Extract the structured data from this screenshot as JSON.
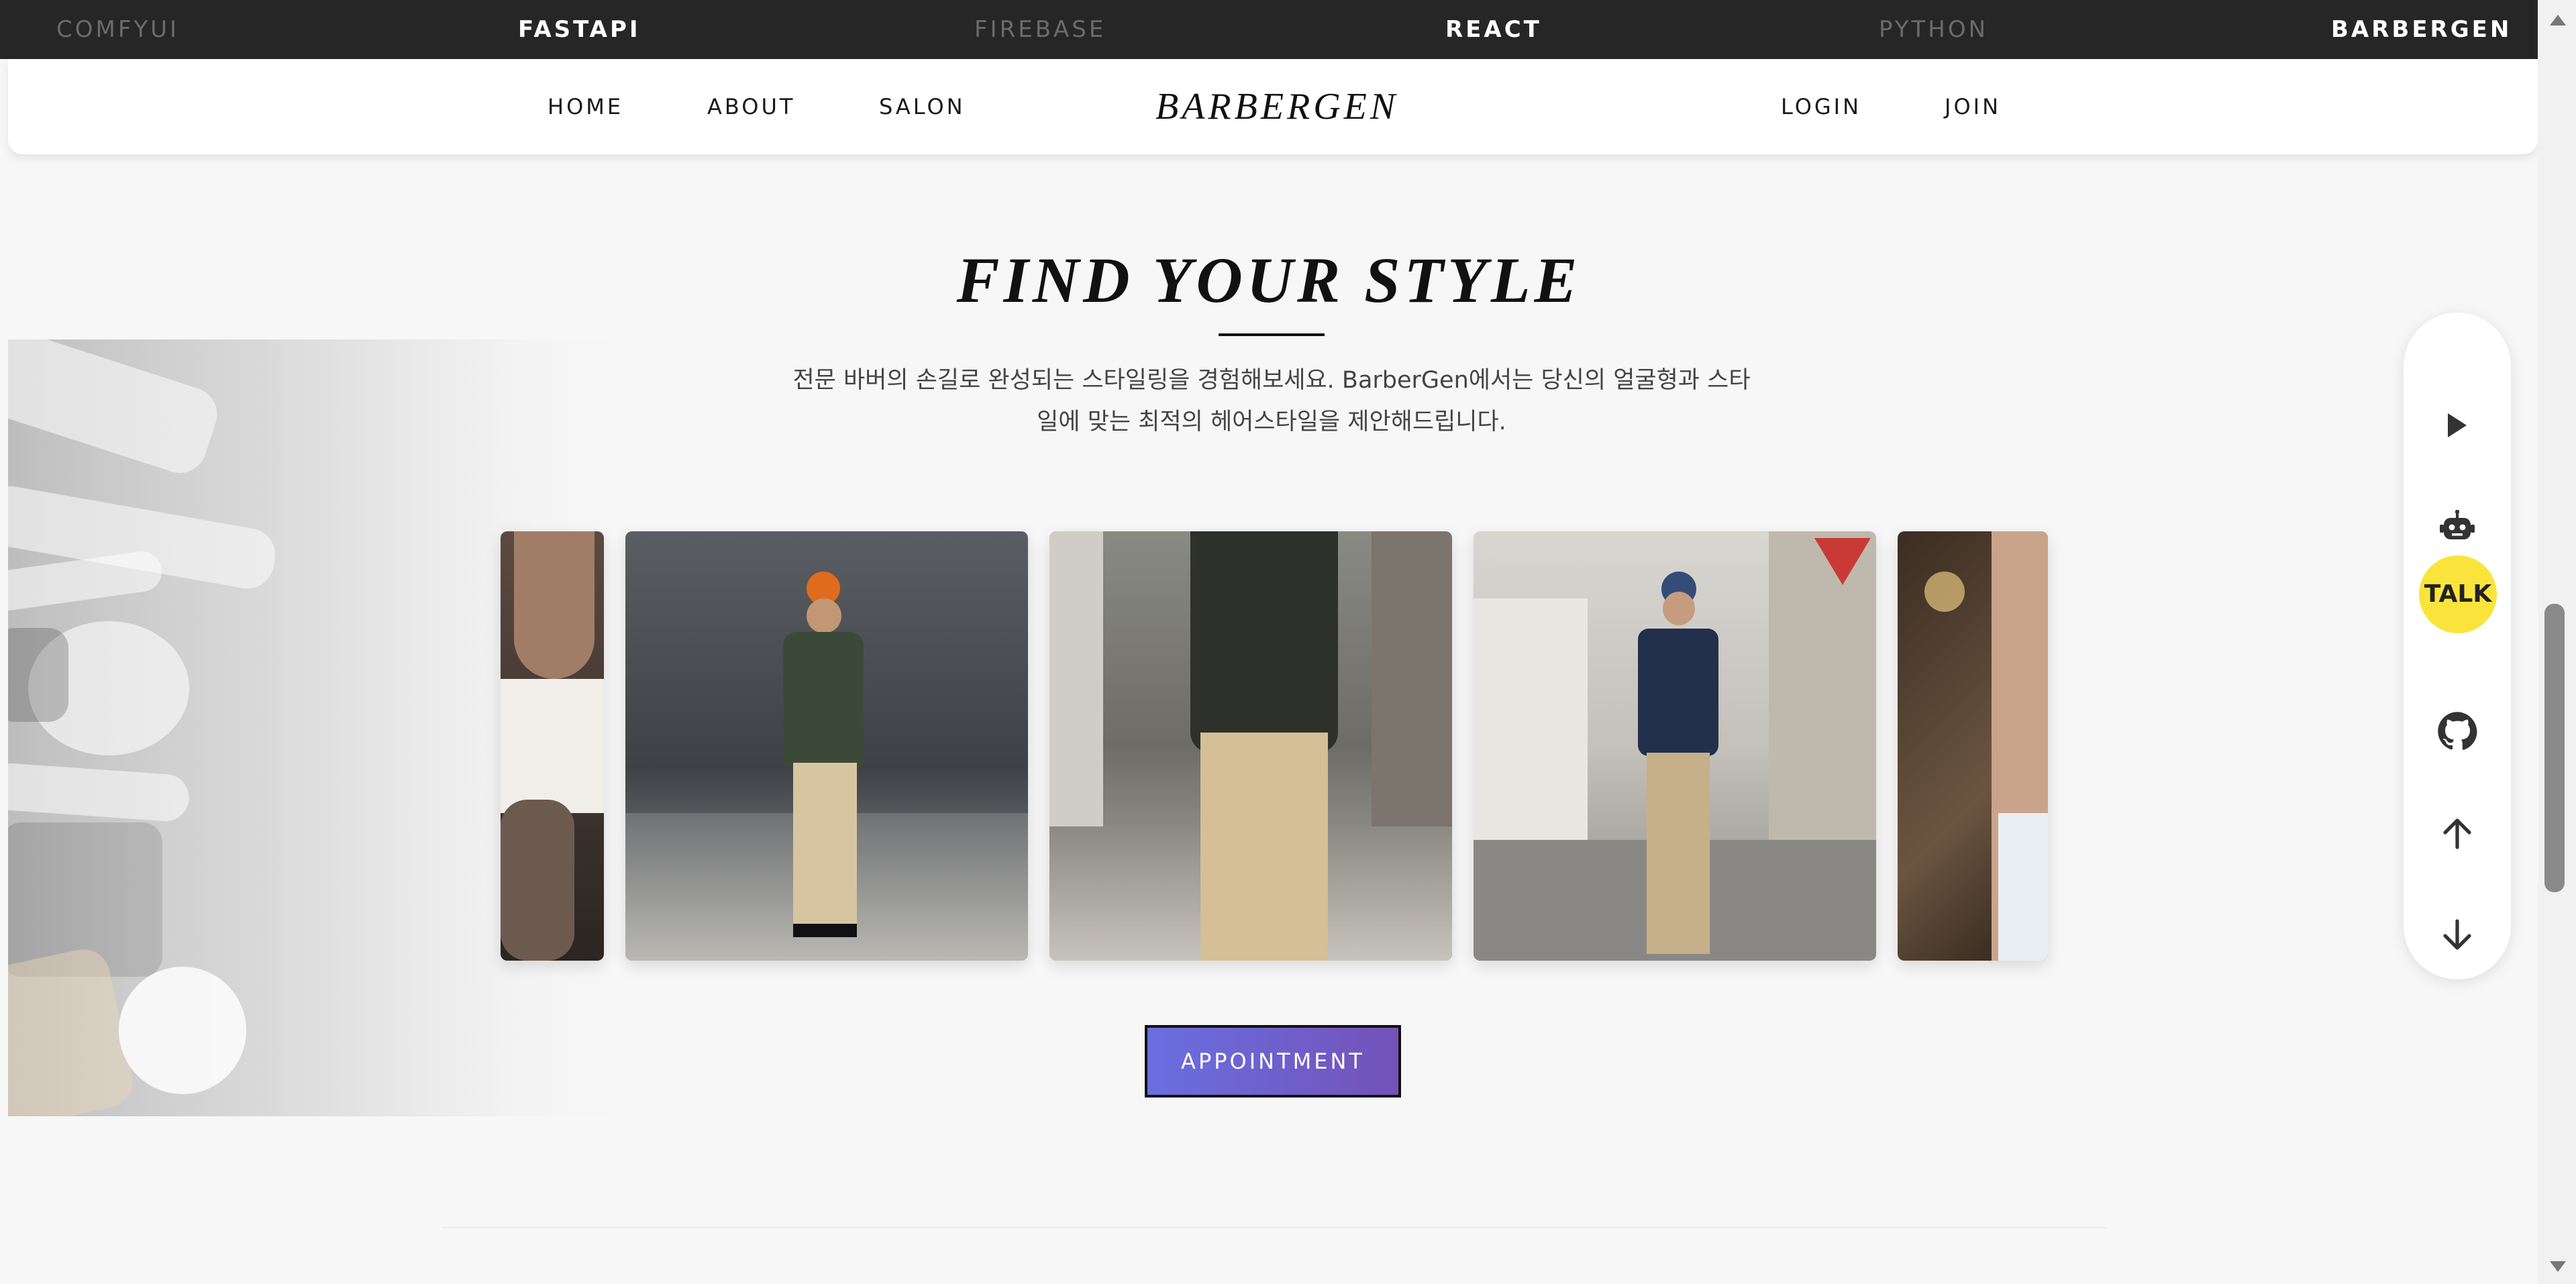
{
  "ticker": {
    "items": [
      {
        "label": "COMFYUI"
      },
      {
        "label": "FASTAPI"
      },
      {
        "label": "FIREBASE"
      },
      {
        "label": "REACT"
      },
      {
        "label": "PYTHON"
      },
      {
        "label": "BARBERGEN"
      }
    ]
  },
  "nav": {
    "logo": "BARBERGEN",
    "home": "HOME",
    "about": "ABOUT",
    "salon": "SALON",
    "login": "LOGIN",
    "join": "JOIN"
  },
  "hero": {
    "title": "FIND YOUR STYLE",
    "desc_line1": "전문 바버의 손길로 완성되는 스타일링을 경험해보세요. BarberGen에서는 당신의 얼굴형과 스타",
    "desc_line2": "일에 맞는 최적의 헤어스타일을 제안해드립니다."
  },
  "appointment": {
    "label": "APPOINTMENT"
  },
  "side_panel": {
    "talk_label": "TALK",
    "icons": [
      "play-icon",
      "robot-icon",
      "github-icon",
      "arrow-up-icon",
      "arrow-down-icon"
    ]
  },
  "colors": {
    "ticker_bg": "#262626",
    "button_gradient_start": "#6a6fe0",
    "button_gradient_end": "#7352b8",
    "talk_yellow": "#fae43c"
  }
}
